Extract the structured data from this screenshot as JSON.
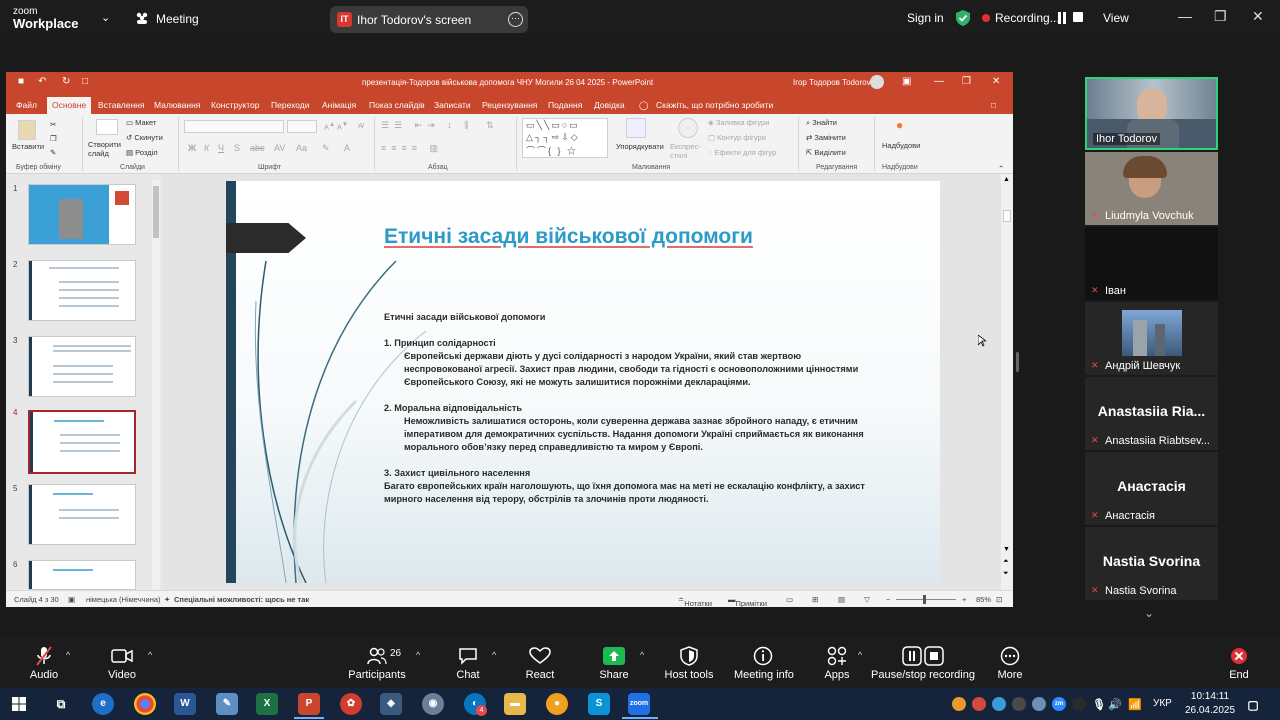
{
  "zoom": {
    "logo_top": "zoom",
    "logo_bottom": "Workplace",
    "meeting_label": "Meeting",
    "share_badge": "IT",
    "share_label": "Ihor Todorov's screen",
    "sign_in": "Sign in",
    "recording": "Recording...",
    "view": "View"
  },
  "ppt": {
    "title": "презентація-Тодоров військова допомога ЧНУ Могили 26 04 2025  -  PowerPoint",
    "user": "Ігор Тодоров Todorov",
    "tabs": [
      "Файл",
      "Основне",
      "Вставлення",
      "Малювання",
      "Конструктор",
      "Переходи",
      "Анімація",
      "Показ слайдів",
      "Записати",
      "Рецензування",
      "Подання",
      "Довідка"
    ],
    "tell_me": "Скажіть, що потрібно зробити",
    "ribbon": {
      "paste": "Вставити",
      "create_slide": "Створити слайд",
      "layout": "Макет",
      "reset": "Скинути",
      "section": "Розділ",
      "clipboard": "Буфер обміну",
      "slides": "Слайди",
      "font": "Шрифт",
      "paragraph": "Абзац",
      "arrange": "Упорядкувати",
      "quick_styles": "Експрес-стилі",
      "shape_fill": "Заливка фігури",
      "shape_outline": "Контур фігури",
      "shape_effects": "Ефекти для фігур",
      "drawing": "Малювання",
      "find": "Знайти",
      "replace": "Замінити",
      "select": "Виділити",
      "editing": "Редагування",
      "addins": "Надбудови",
      "addins_group": "Надбудови"
    },
    "thumb_numbers": [
      "1",
      "2",
      "3",
      "4",
      "5",
      "6"
    ],
    "slide": {
      "title": "Етичні засади військової допомоги",
      "heading": "Етичні засади військової допомоги",
      "s1_title": "1. Принцип солідарності",
      "s1_l1": "Європейські держави діють у дусі солідарності з народом України, який став жертвою",
      "s1_l2": "неспровокованої агресії. Захист прав людини, свободи та гідності є основоположними цінностями",
      "s1_l3": "Європейського Союзу, які не можуть залишитися порожніми деклараціями.",
      "s2_title": "2. Моральна відповідальність",
      "s2_l1": "Неможливість залишатися осторонь, коли суверенна держава зазнає збройного нападу, є етичним",
      "s2_l2": "імперативом для демократичних суспільств. Надання допомоги Україні сприймається як виконання",
      "s2_l3": "морального обов’язку перед справедливістю та миром у Європі.",
      "s3_title": "3. Захист цивільного населення",
      "s3_l1": "Багато європейських країн наголошують, що їхня допомога має на меті не ескалацію конфлікту, а захист",
      "s3_l2": "мирного населення від терору, обстрілів та злочинів проти людяності."
    },
    "status": {
      "slide": "Слайд 4 з 30",
      "lang": "німецька (Німеччина)",
      "accessibility": "Спеціальні можливості: щось не так",
      "notes": "Нотатки",
      "comments": "Примітки",
      "zoom": "85%"
    }
  },
  "participants": [
    {
      "name": "Ihor Todorov",
      "muted": false,
      "big": ""
    },
    {
      "name": "Liudmyla Vovchuk",
      "muted": true,
      "big": ""
    },
    {
      "name": "Іван",
      "muted": true,
      "big": ""
    },
    {
      "name": "Андрій Шевчук",
      "muted": true,
      "big": ""
    },
    {
      "name": "Anastasiia Riabtsev...",
      "muted": true,
      "big": "Anastasiia  Ria..."
    },
    {
      "name": "Анастасія",
      "muted": true,
      "big": "Анастасія"
    },
    {
      "name": "Nastia Svorina",
      "muted": true,
      "big": "Nastia Svorina"
    }
  ],
  "toolbar": {
    "audio": "Audio",
    "video": "Video",
    "participants": "Participants",
    "participants_count": "26",
    "chat": "Chat",
    "react": "React",
    "share": "Share",
    "host_tools": "Host tools",
    "meeting_info": "Meeting info",
    "apps": "Apps",
    "pause_stop": "Pause/stop recording",
    "more": "More",
    "end": "End"
  },
  "taskbar": {
    "lang": "УКР",
    "time": "10:14:11",
    "date": "26.04.2025",
    "chrome_badge": "4"
  },
  "colors": {
    "ppt_accent": "#c8462b",
    "slide_title": "#2e9ac8",
    "active_speaker": "#2fd27a",
    "record_red": "#e03030",
    "share_green": "#1db954"
  }
}
